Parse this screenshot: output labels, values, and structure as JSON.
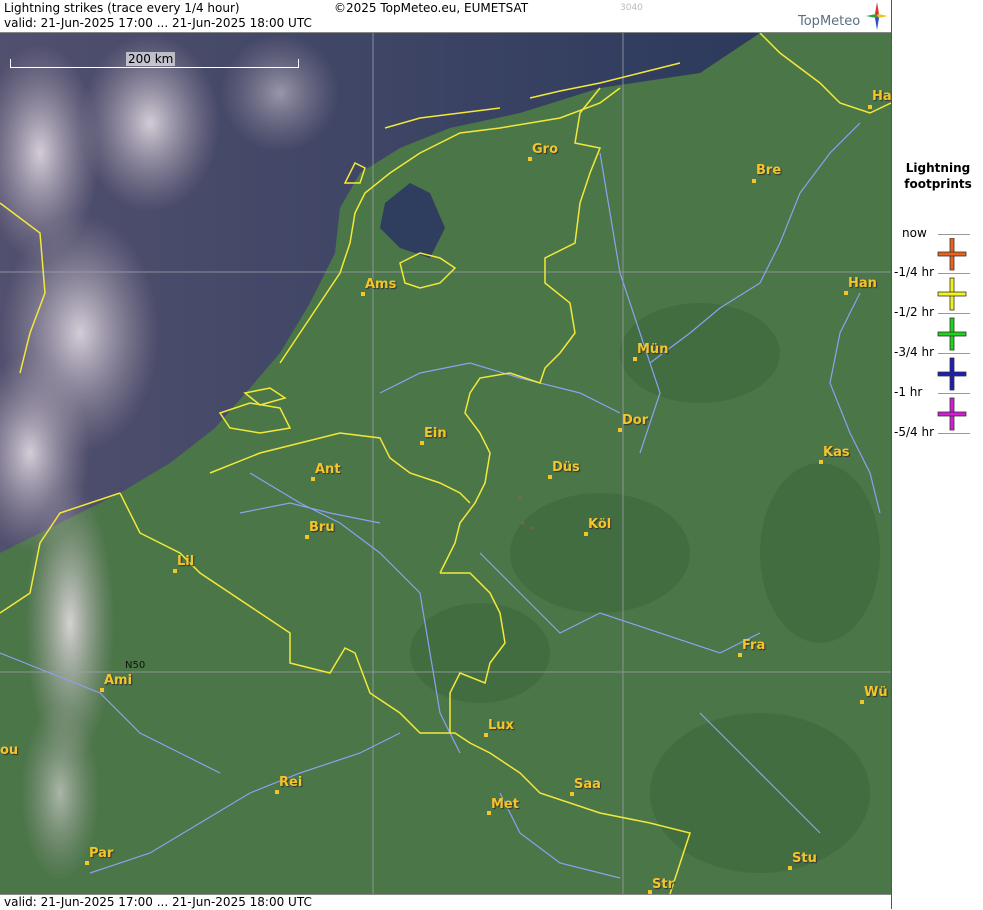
{
  "header": {
    "title": "Lightning strikes (trace every 1/4 hour)",
    "copyright": "©2025 TopMeteo.eu, EUMETSAT",
    "code": "3040",
    "valid": "valid:  21-Jun-2025 17:00 ... 21-Jun-2025 18:00 UTC",
    "logo_text": "TopMeteo"
  },
  "footer": {
    "valid": "valid:  21-Jun-2025 17:00 ... 21-Jun-2025 18:00 UTC"
  },
  "map": {
    "scale_label": "200 km",
    "latitude_label": "N50",
    "cities": [
      {
        "label": "Gro"
      },
      {
        "label": "Bre"
      },
      {
        "label": "Ha"
      },
      {
        "label": "Ams"
      },
      {
        "label": "Han"
      },
      {
        "label": "Mün"
      },
      {
        "label": "Dor"
      },
      {
        "label": "Ein"
      },
      {
        "label": "Ant"
      },
      {
        "label": "Düs"
      },
      {
        "label": "Kas"
      },
      {
        "label": "Bru"
      },
      {
        "label": "Köl"
      },
      {
        "label": "Lil"
      },
      {
        "label": "Ami"
      },
      {
        "label": "Fra"
      },
      {
        "label": "Wü"
      },
      {
        "label": "Lux"
      },
      {
        "label": "ou"
      },
      {
        "label": "Rei"
      },
      {
        "label": "Saa"
      },
      {
        "label": "Met"
      },
      {
        "label": "Par"
      },
      {
        "label": "Stu"
      },
      {
        "label": "Str"
      }
    ],
    "colors": {
      "border": "#f2e83a",
      "rivers": "#8f9ff0",
      "land": "#4d7a4a",
      "sea": "#2d3a5a",
      "city": "#f4c528"
    }
  },
  "legend": {
    "title_line1": "Lightning",
    "title_line2": "footprints",
    "labels": [
      "now",
      "-1/4 hr",
      "-1/2 hr",
      "-3/4 hr",
      "-1 hr",
      "-5/4 hr"
    ],
    "markers": [
      {
        "icon": "orange-cross-icon",
        "color": "#e8641e"
      },
      {
        "icon": "yellow-cross-icon",
        "color": "#f2f21e"
      },
      {
        "icon": "green-cross-icon",
        "color": "#1ed21e"
      },
      {
        "icon": "blue-cross-icon",
        "color": "#1e1eb4"
      },
      {
        "icon": "magenta-cross-icon",
        "color": "#d21ed2"
      }
    ]
  }
}
